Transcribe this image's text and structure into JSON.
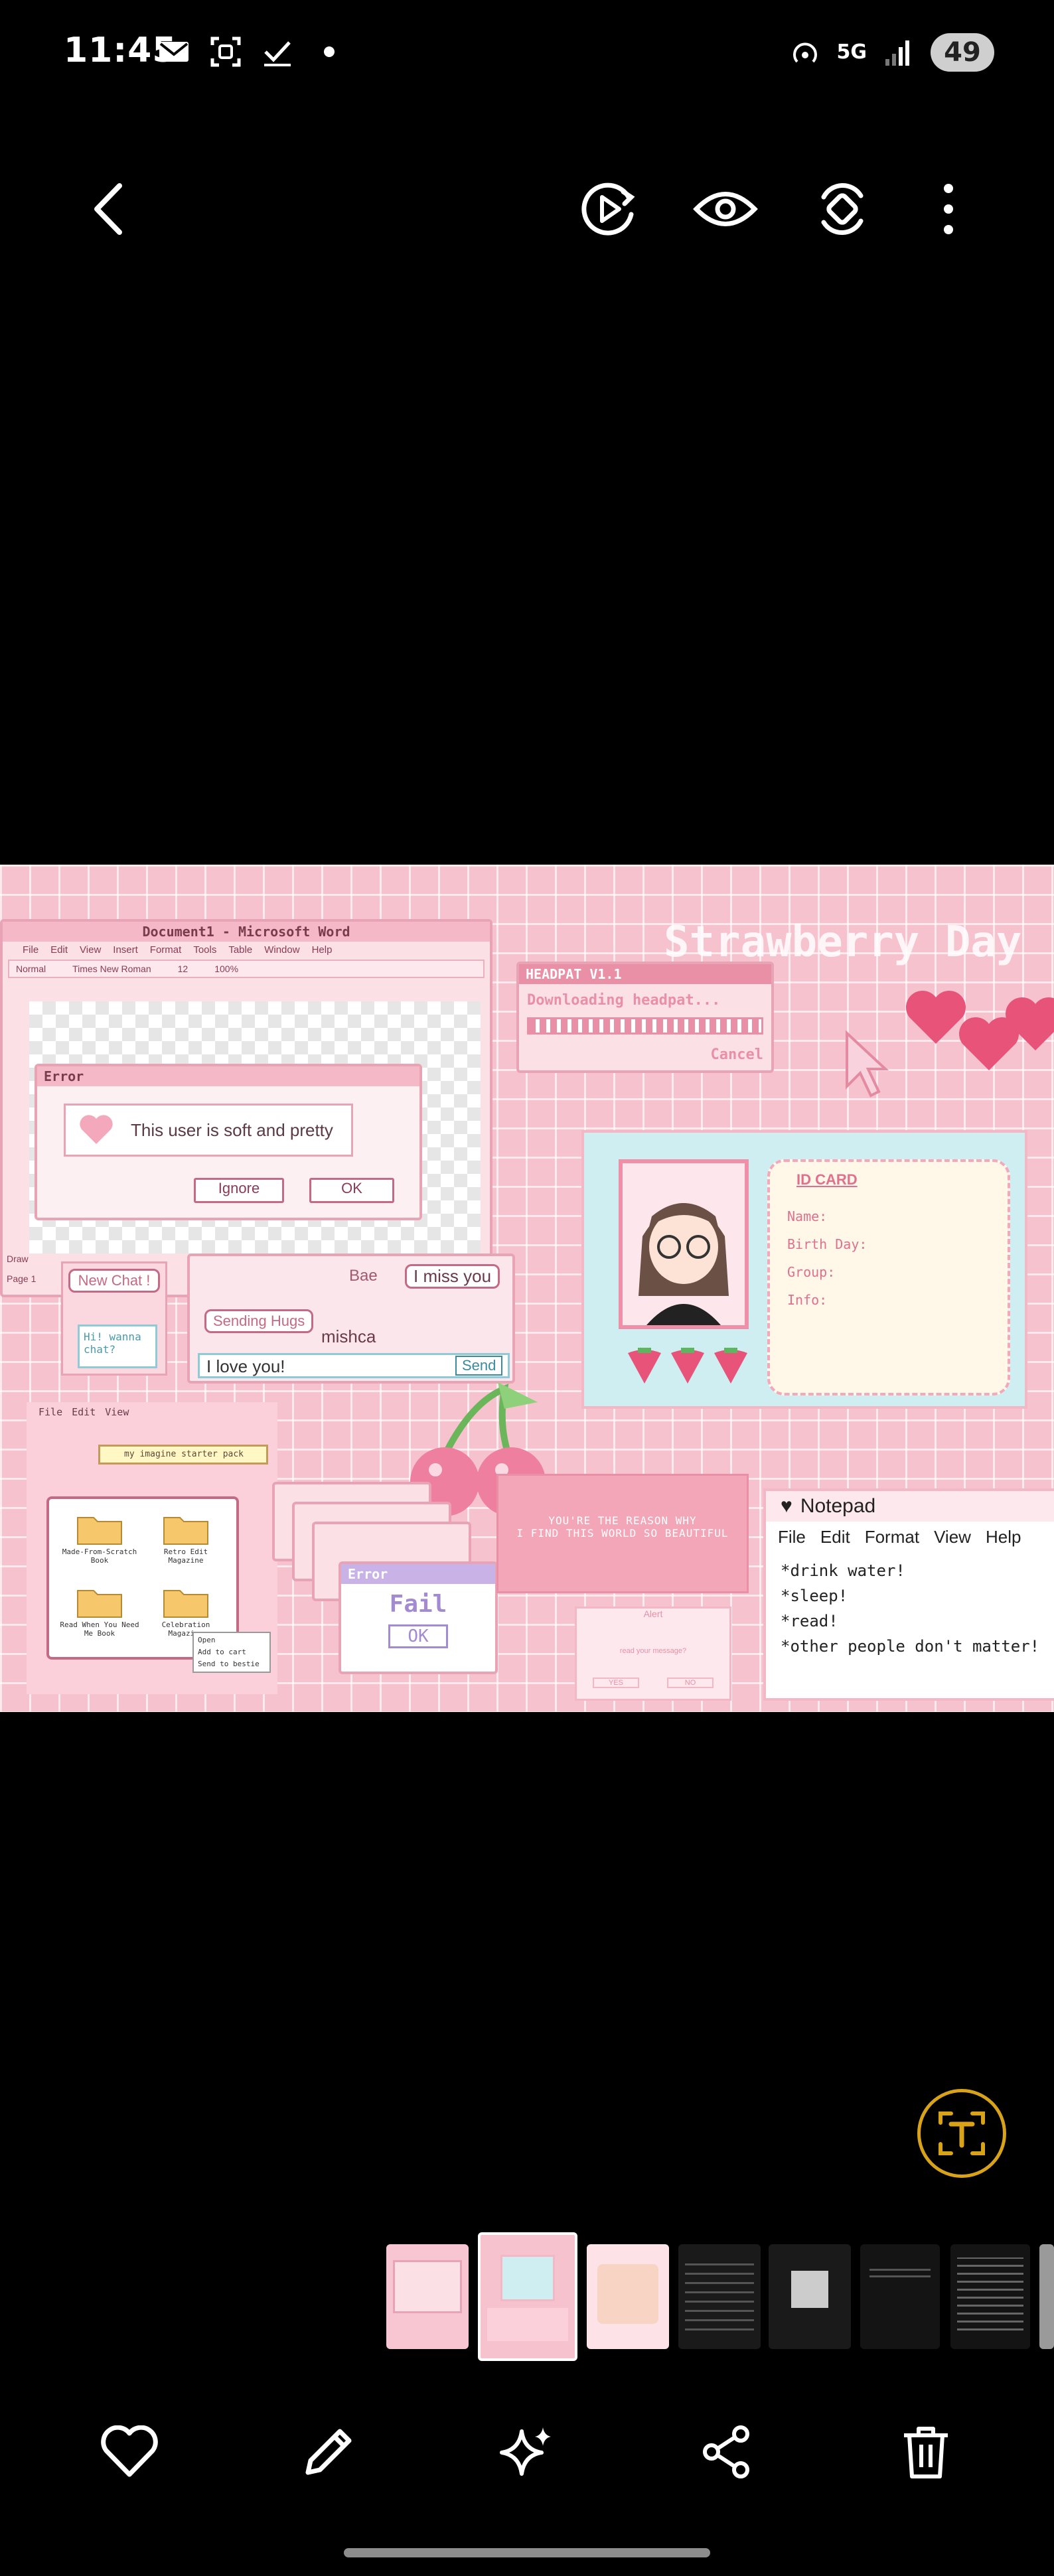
{
  "status_bar": {
    "time": "11:45",
    "left_icons": [
      "mail-icon",
      "screenshot-icon",
      "check-icon",
      "dot-icon"
    ],
    "network": "5G",
    "battery": "49"
  },
  "toolbar": {
    "back": "back-arrow-icon",
    "motion_photo": "play-circle-icon",
    "view": "eye-icon",
    "remaster": "rotate-icon",
    "more": "more-vert-icon"
  },
  "photo": {
    "word_title": "Document1 - Microsoft Word",
    "word_menu": [
      "File",
      "Edit",
      "View",
      "Insert",
      "Format",
      "Tools",
      "Table",
      "Window",
      "Help"
    ],
    "word_font": "Times New Roman",
    "word_size": "12",
    "word_zoom": "100%",
    "word_style": "Normal",
    "error_title": "Error",
    "error_msg": "This user is soft and pretty",
    "error_ignore": "Ignore",
    "error_ok": "OK",
    "draw": "Draw",
    "page": "Page 1",
    "new_chat": "New Chat !",
    "chat_bubble": "Hi! wanna chat?",
    "chat_bae": "Bae",
    "chat_miss": "I miss you",
    "chat_hugs": "Sending Hugs",
    "chat_name": "mishca",
    "chat_input": "I love you!",
    "chat_send": "Send",
    "headpat_title": "HEADPAT V1.1",
    "headpat_status": "Downloading headpat...",
    "headpat_cancel": "Cancel",
    "banner": "Strawberry Day",
    "id_card_title": "ID CARD",
    "id_name": "Name:",
    "id_birthday": "Birth Day:",
    "id_group": "Group:",
    "id_info": "Info:",
    "folder_menu": [
      "File",
      "Edit",
      "View"
    ],
    "folder_search": "my imagine starter pack",
    "folders": [
      "Made-From-Scratch Book",
      "Retro Edit Magazine",
      "Read When You Need Me Book",
      "Celebration Magazine"
    ],
    "context_menu": [
      "Open",
      "Add to cart",
      "Send to bestie"
    ],
    "error_stack_title": "Error",
    "error_stack_body": "Fail",
    "error_stack_ok": "OK",
    "love_msg_1": "YOU'RE THE REASON WHY",
    "love_msg_2": "I FIND THIS WORLD SO BEAUTIFUL",
    "alert_title": "Alert",
    "alert_msg": "read your message?",
    "alert_yes": "YES",
    "alert_no": "NO",
    "notepad_title": "Notepad",
    "notepad_menu": [
      "File",
      "Edit",
      "Format",
      "View",
      "Help"
    ],
    "notepad_lines": [
      "*drink water!",
      "*sleep!",
      "*read!",
      "*other people don't matter!"
    ]
  },
  "lens": "text-scan-icon",
  "filmstrip": {
    "count": 8,
    "selected_index": 1
  },
  "actions": {
    "favorite": "heart-icon",
    "edit": "pencil-icon",
    "ai": "sparkle-icon",
    "share": "share-icon",
    "delete": "trash-icon"
  },
  "colors": {
    "pink_bg": "#f6c2cd",
    "pink_dark": "#c46a84",
    "lens_ring": "#d8a318"
  }
}
